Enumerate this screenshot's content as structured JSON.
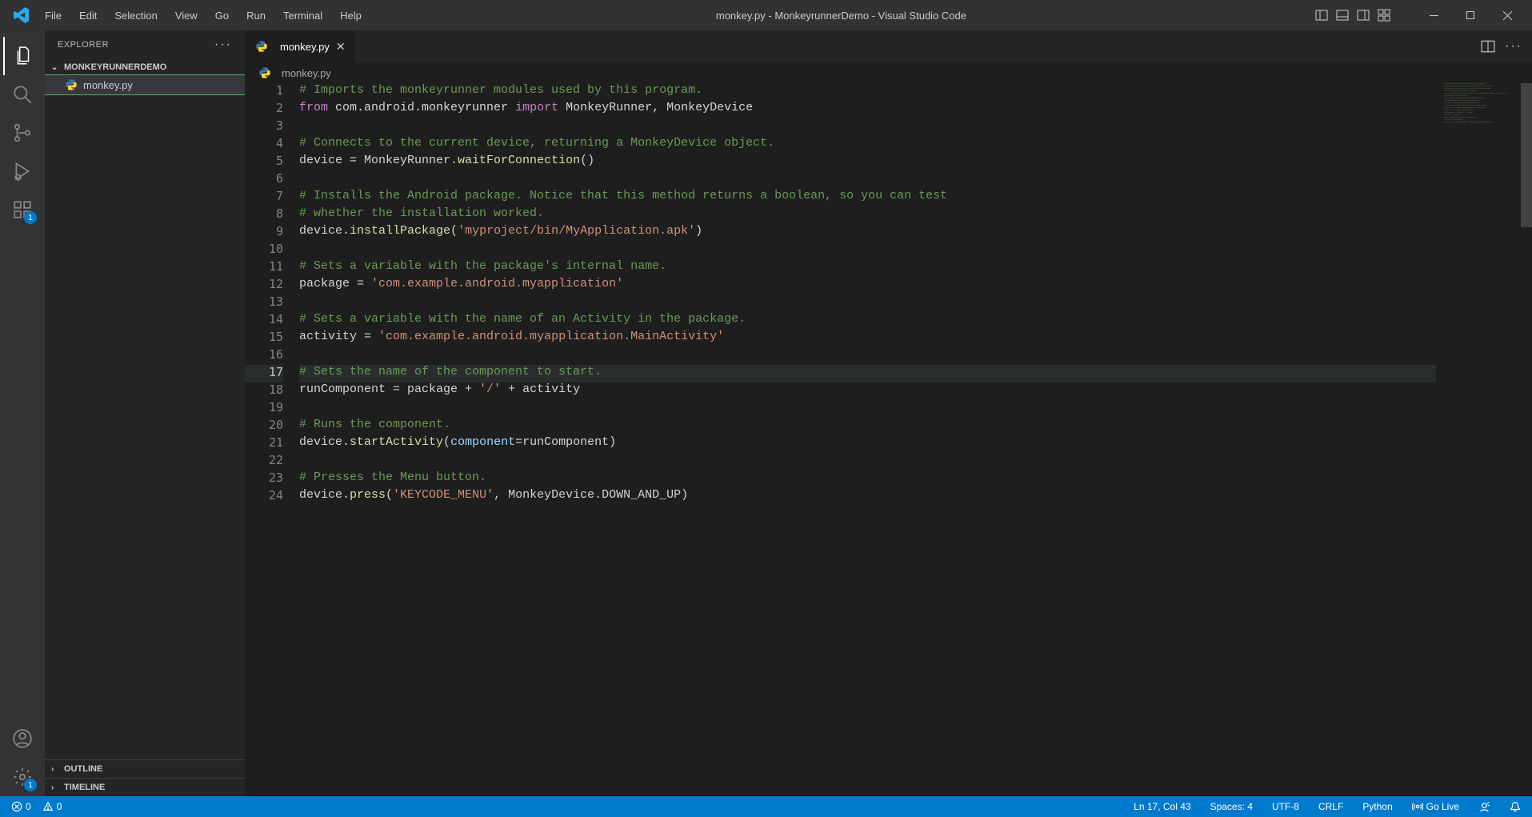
{
  "title": "monkey.py - MonkeyrunnerDemo - Visual Studio Code",
  "menus": [
    "File",
    "Edit",
    "Selection",
    "View",
    "Go",
    "Run",
    "Terminal",
    "Help"
  ],
  "activity": {
    "extensions_badge": "1",
    "manage_badge": "1"
  },
  "sidebar": {
    "header": "EXPLORER",
    "project": "MONKEYRUNNERDEMO",
    "file": "monkey.py",
    "outline": "OUTLINE",
    "timeline": "TIMELINE"
  },
  "tab": {
    "name": "monkey.py"
  },
  "breadcrumb": {
    "file": "monkey.py"
  },
  "code": {
    "lines": [
      [
        {
          "c": "comment",
          "t": "# Imports the monkeyrunner modules used by this program."
        }
      ],
      [
        {
          "c": "keyword",
          "t": "from"
        },
        {
          "c": "plain",
          "t": " com.android.monkeyrunner "
        },
        {
          "c": "keyword",
          "t": "import"
        },
        {
          "c": "plain",
          "t": " MonkeyRunner, MonkeyDevice"
        }
      ],
      [],
      [
        {
          "c": "comment",
          "t": "# Connects to the current device, returning a MonkeyDevice object."
        }
      ],
      [
        {
          "c": "plain",
          "t": "device = MonkeyRunner."
        },
        {
          "c": "func",
          "t": "waitForConnection"
        },
        {
          "c": "punc",
          "t": "()"
        }
      ],
      [],
      [
        {
          "c": "comment",
          "t": "# Installs the Android package. Notice that this method returns a boolean, so you can test"
        }
      ],
      [
        {
          "c": "comment",
          "t": "# whether the installation worked."
        }
      ],
      [
        {
          "c": "plain",
          "t": "device."
        },
        {
          "c": "func",
          "t": "installPackage"
        },
        {
          "c": "punc",
          "t": "("
        },
        {
          "c": "string",
          "t": "'myproject/bin/MyApplication.apk'"
        },
        {
          "c": "punc",
          "t": ")"
        }
      ],
      [],
      [
        {
          "c": "comment",
          "t": "# Sets a variable with the package's internal name."
        }
      ],
      [
        {
          "c": "plain",
          "t": "package = "
        },
        {
          "c": "string",
          "t": "'com.example.android.myapplication'"
        }
      ],
      [],
      [
        {
          "c": "comment",
          "t": "# Sets a variable with the name of an Activity in the package."
        }
      ],
      [
        {
          "c": "plain",
          "t": "activity = "
        },
        {
          "c": "string",
          "t": "'com.example.android.myapplication.MainActivity'"
        }
      ],
      [],
      [
        {
          "c": "comment",
          "t": "# Sets the name of the component to start."
        }
      ],
      [
        {
          "c": "plain",
          "t": "runComponent = package + "
        },
        {
          "c": "string",
          "t": "'/'"
        },
        {
          "c": "plain",
          "t": " + activity"
        }
      ],
      [],
      [
        {
          "c": "comment",
          "t": "# Runs the component."
        }
      ],
      [
        {
          "c": "plain",
          "t": "device."
        },
        {
          "c": "func",
          "t": "startActivity"
        },
        {
          "c": "punc",
          "t": "("
        },
        {
          "c": "param",
          "t": "component"
        },
        {
          "c": "plain",
          "t": "=runComponent"
        },
        {
          "c": "punc",
          "t": ")"
        }
      ],
      [],
      [
        {
          "c": "comment",
          "t": "# Presses the Menu button."
        }
      ],
      [
        {
          "c": "plain",
          "t": "device."
        },
        {
          "c": "func",
          "t": "press"
        },
        {
          "c": "punc",
          "t": "("
        },
        {
          "c": "string",
          "t": "'KEYCODE_MENU'"
        },
        {
          "c": "plain",
          "t": ", MonkeyDevice.DOWN_AND_UP"
        },
        {
          "c": "punc",
          "t": ")"
        }
      ]
    ],
    "currentLine": 17
  },
  "status": {
    "errors": "0",
    "warnings": "0",
    "position": "Ln 17, Col 43",
    "spaces": "Spaces: 4",
    "encoding": "UTF-8",
    "eol": "CRLF",
    "language": "Python",
    "golive": "Go Live"
  }
}
